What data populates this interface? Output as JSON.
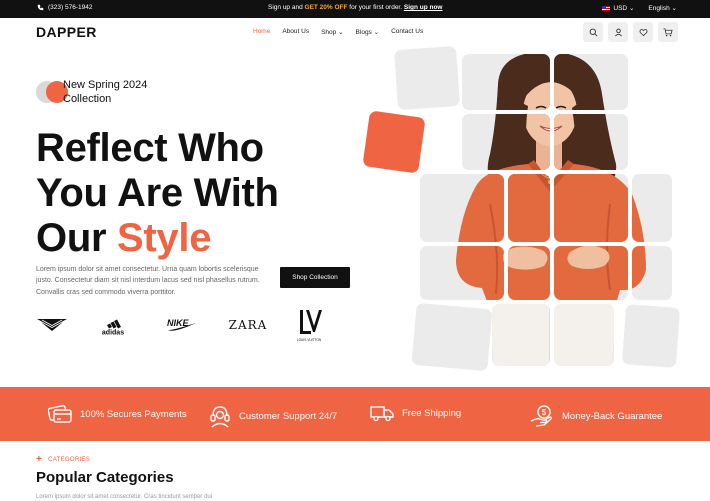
{
  "topbar": {
    "phone": "(323) 576-1942",
    "promo_prefix": "Sign up and ",
    "promo_highlight": "GET 20% OFF",
    "promo_mid": " for your first order. ",
    "promo_link": "Sign up now",
    "currency": "USD",
    "language": "English"
  },
  "nav": {
    "logo": "DAPPER",
    "items": [
      {
        "label": "Home",
        "active": true
      },
      {
        "label": "About Us",
        "active": false
      },
      {
        "label": "Shop",
        "active": false
      },
      {
        "label": "Blogs",
        "active": false
      },
      {
        "label": "Contact Us",
        "active": false
      }
    ]
  },
  "hero": {
    "badge_line1": "New Spring 2024",
    "badge_line2": "Collection",
    "headline_line1": "Reflect Who",
    "headline_line2": "You Are With",
    "headline_line3_prefix": "Our ",
    "headline_line3_accent": "Style",
    "description": "Lorem ipsum dolor sit amet consectetur. Urna quam lobortis scelerisque justo. Consectetur diam sit nisl interdum lacus sed nisl phasellus rutrum. Convallis cras sed commodo viverra porttitor.",
    "cta_label": "Shop Collection"
  },
  "brands": [
    "armani-logo",
    "adidas",
    "NIKE",
    "ZARA",
    "LOUIS VUITTON"
  ],
  "features": [
    {
      "icon": "credit-card-icon",
      "label": "100% Secures Payments"
    },
    {
      "icon": "headset-icon",
      "label": "Customer Support 24/7"
    },
    {
      "icon": "truck-icon",
      "label": "Free Shipping"
    },
    {
      "icon": "money-back-icon",
      "label": "Money-Back Guarantee"
    }
  ],
  "categories": {
    "tag": "CATEGORIES",
    "title": "Popular Categories",
    "description": "Lorem ipsum dolor sit amet consectetur. Cras tincidunt semper dui"
  },
  "colors": {
    "accent": "#ef6442",
    "dark": "#111111",
    "tile": "#ebebeb"
  }
}
